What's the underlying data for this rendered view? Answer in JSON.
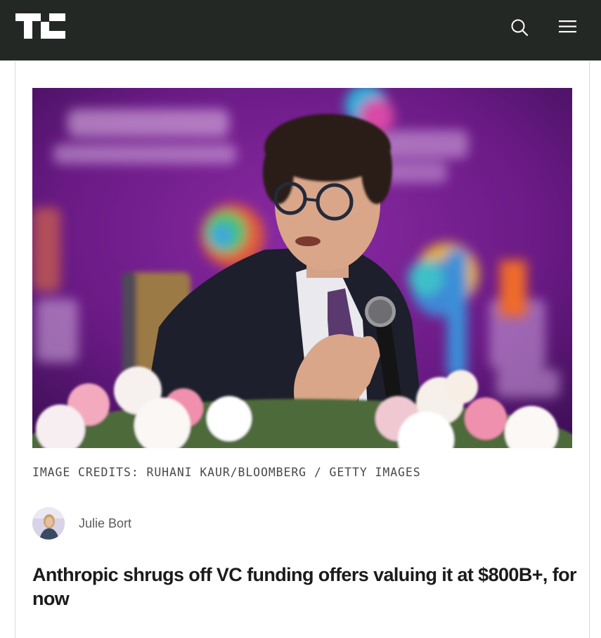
{
  "header": {
    "logo_text": "TC",
    "background_color": "#232825",
    "icons": {
      "search": "search-icon",
      "menu": "hamburger-menu-icon"
    }
  },
  "article": {
    "hero_image_alt": "Man with curly hair and round glasses speaking into a microphone on a purple stage with flowers in the foreground",
    "image_credits": "IMAGE CREDITS: RUHANI KAUR/BLOOMBERG / GETTY IMAGES",
    "author": {
      "name": "Julie Bort"
    },
    "headline": "Anthropic shrugs off VC funding offers valuing it at $800B+, for now"
  }
}
